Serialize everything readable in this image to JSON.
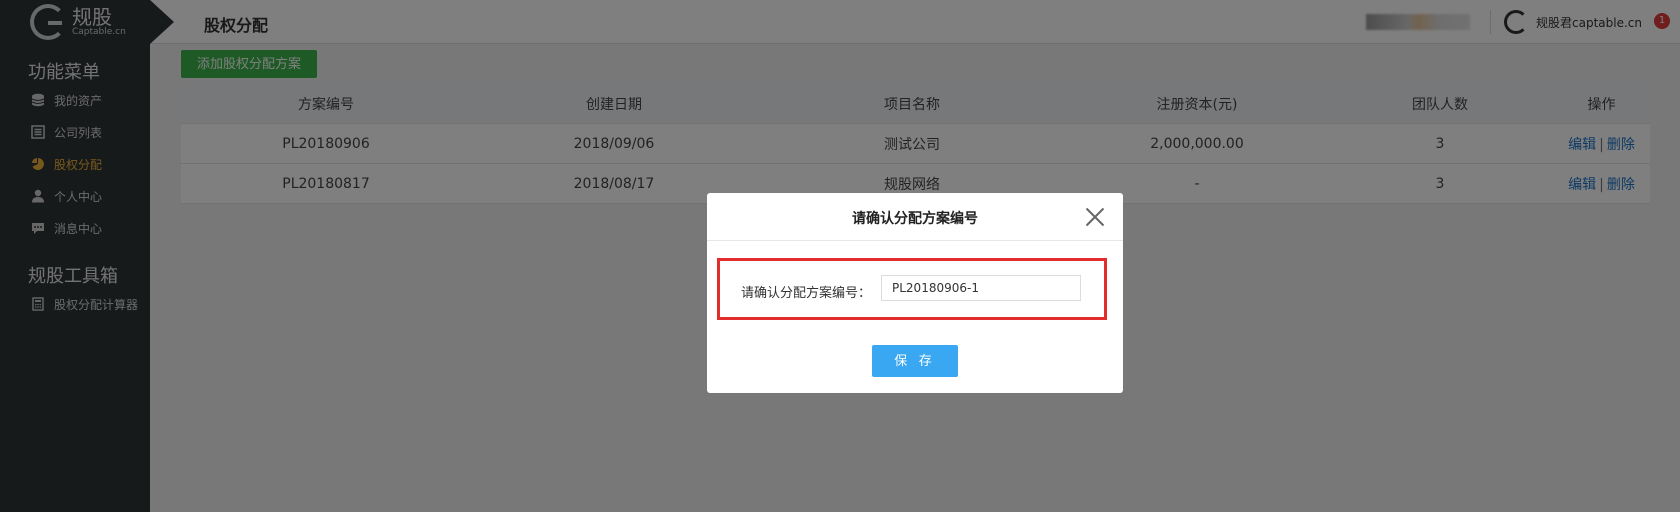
{
  "brand": {
    "title": "规股",
    "subtitle": "Captable.cn"
  },
  "header": {
    "page_title": "股权分配",
    "username": "规股君captable.cn",
    "notification_count": "1"
  },
  "sidebar": {
    "section1_title": "功能菜单",
    "items": [
      {
        "label": "我的资产",
        "icon": "database-icon"
      },
      {
        "label": "公司列表",
        "icon": "list-icon"
      },
      {
        "label": "股权分配",
        "icon": "pie-chart-icon",
        "active": true
      },
      {
        "label": "个人中心",
        "icon": "user-icon"
      },
      {
        "label": "消息中心",
        "icon": "message-icon"
      }
    ],
    "section2_title": "规股工具箱",
    "tools": [
      {
        "label": "股权分配计算器",
        "icon": "calculator-icon"
      }
    ]
  },
  "main": {
    "add_button": "添加股权分配方案",
    "table": {
      "headers": [
        "方案编号",
        "创建日期",
        "项目名称",
        "注册资本(元)",
        "团队人数",
        "操作"
      ],
      "rows": [
        {
          "id": "PL20180906",
          "date": "2018/09/06",
          "name": "测试公司",
          "capital": "2,000,000.00",
          "team": "3",
          "edit": "编辑",
          "sep": "|",
          "delete": "删除"
        },
        {
          "id": "PL20180817",
          "date": "2018/08/17",
          "name": "规股网络",
          "capital": "-",
          "team": "3",
          "edit": "编辑",
          "sep": "|",
          "delete": "删除"
        }
      ]
    }
  },
  "modal": {
    "title": "请确认分配方案编号",
    "field_label": "请确认分配方案编号：",
    "field_value": "PL20180906-1",
    "save_button": "保 存"
  },
  "colors": {
    "accent": "#f0b33b",
    "highlight_border": "#e32d2d",
    "save_button": "#3aa7f2",
    "add_button": "#3bb54a"
  }
}
